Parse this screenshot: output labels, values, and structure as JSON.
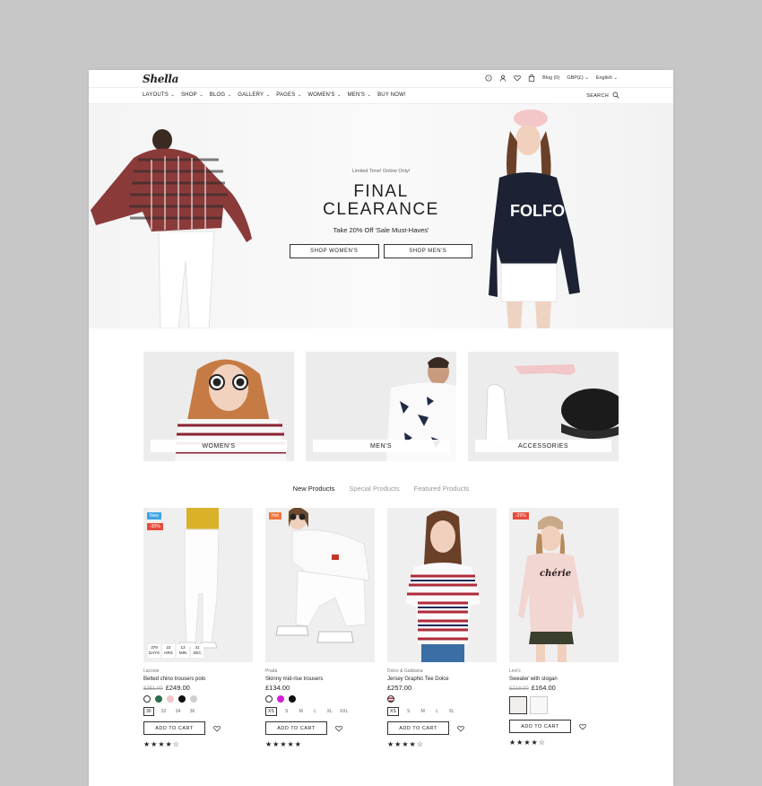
{
  "header": {
    "logo": "Shella",
    "blog": "Blog (0)",
    "currency": "GBP(£)",
    "language": "English",
    "search": "SEARCH"
  },
  "nav": [
    "LAYOUTS",
    "SHOP",
    "BLOG",
    "GALLERY",
    "PAGES",
    "WOMEN'S",
    "MEN'S",
    "BUY NOW!"
  ],
  "hero": {
    "kicker": "Limited Time! Online Only!",
    "title_line1": "FINAL",
    "title_line2": "CLEARANCE",
    "subtitle": "Take 20% Off 'Sale Must-Haves'",
    "btn_women": "SHOP WOMEN'S",
    "btn_men": "SHOP MEN'S"
  },
  "categories": [
    "WOMEN'S",
    "MEN'S",
    "ACCESSORIES"
  ],
  "tabs": [
    "New Products",
    "Special Products",
    "Featured Products"
  ],
  "products": [
    {
      "badges": [
        {
          "text": "New",
          "color": "#3aa4e6"
        },
        {
          "text": "-30%",
          "color": "#e64b3c"
        }
      ],
      "countdown": [
        {
          "n": "379",
          "u": "DAYS"
        },
        {
          "n": "22",
          "u": "HRS"
        },
        {
          "n": "13",
          "u": "MIN"
        },
        {
          "n": "41",
          "u": "SEC"
        }
      ],
      "brand": "Lacoste",
      "name": "Belted chino trousers polo",
      "old_price": "£351.00",
      "price": "£249.00",
      "sizes": [
        "30",
        "32",
        "34",
        "36"
      ],
      "cart": "ADD TO CART",
      "stars": "★★★★☆"
    },
    {
      "badges": [
        {
          "text": "Hot",
          "color": "#f0743c"
        }
      ],
      "brand": "Prada",
      "name": "Skinny mid-rise trousers",
      "price": "£134.00",
      "sizes": [
        "XS",
        "S",
        "M",
        "L",
        "XL",
        "XXL"
      ],
      "cart": "ADD TO CART",
      "stars": "★★★★★"
    },
    {
      "brand": "Dolce & Gabbana",
      "name": "Jersey Graphic Tee Dolce",
      "price": "£257.00",
      "sizes": [
        "XS",
        "S",
        "M",
        "L",
        "XL"
      ],
      "cart": "ADD TO CART",
      "stars": "★★★★☆"
    },
    {
      "badges": [
        {
          "text": "-25%",
          "color": "#e64b3c"
        }
      ],
      "brand": "Levi's",
      "name": "Sweater with slogan",
      "old_price": "£218.00",
      "price": "£164.00",
      "cart": "ADD TO CART",
      "stars": "★★★★☆"
    }
  ]
}
